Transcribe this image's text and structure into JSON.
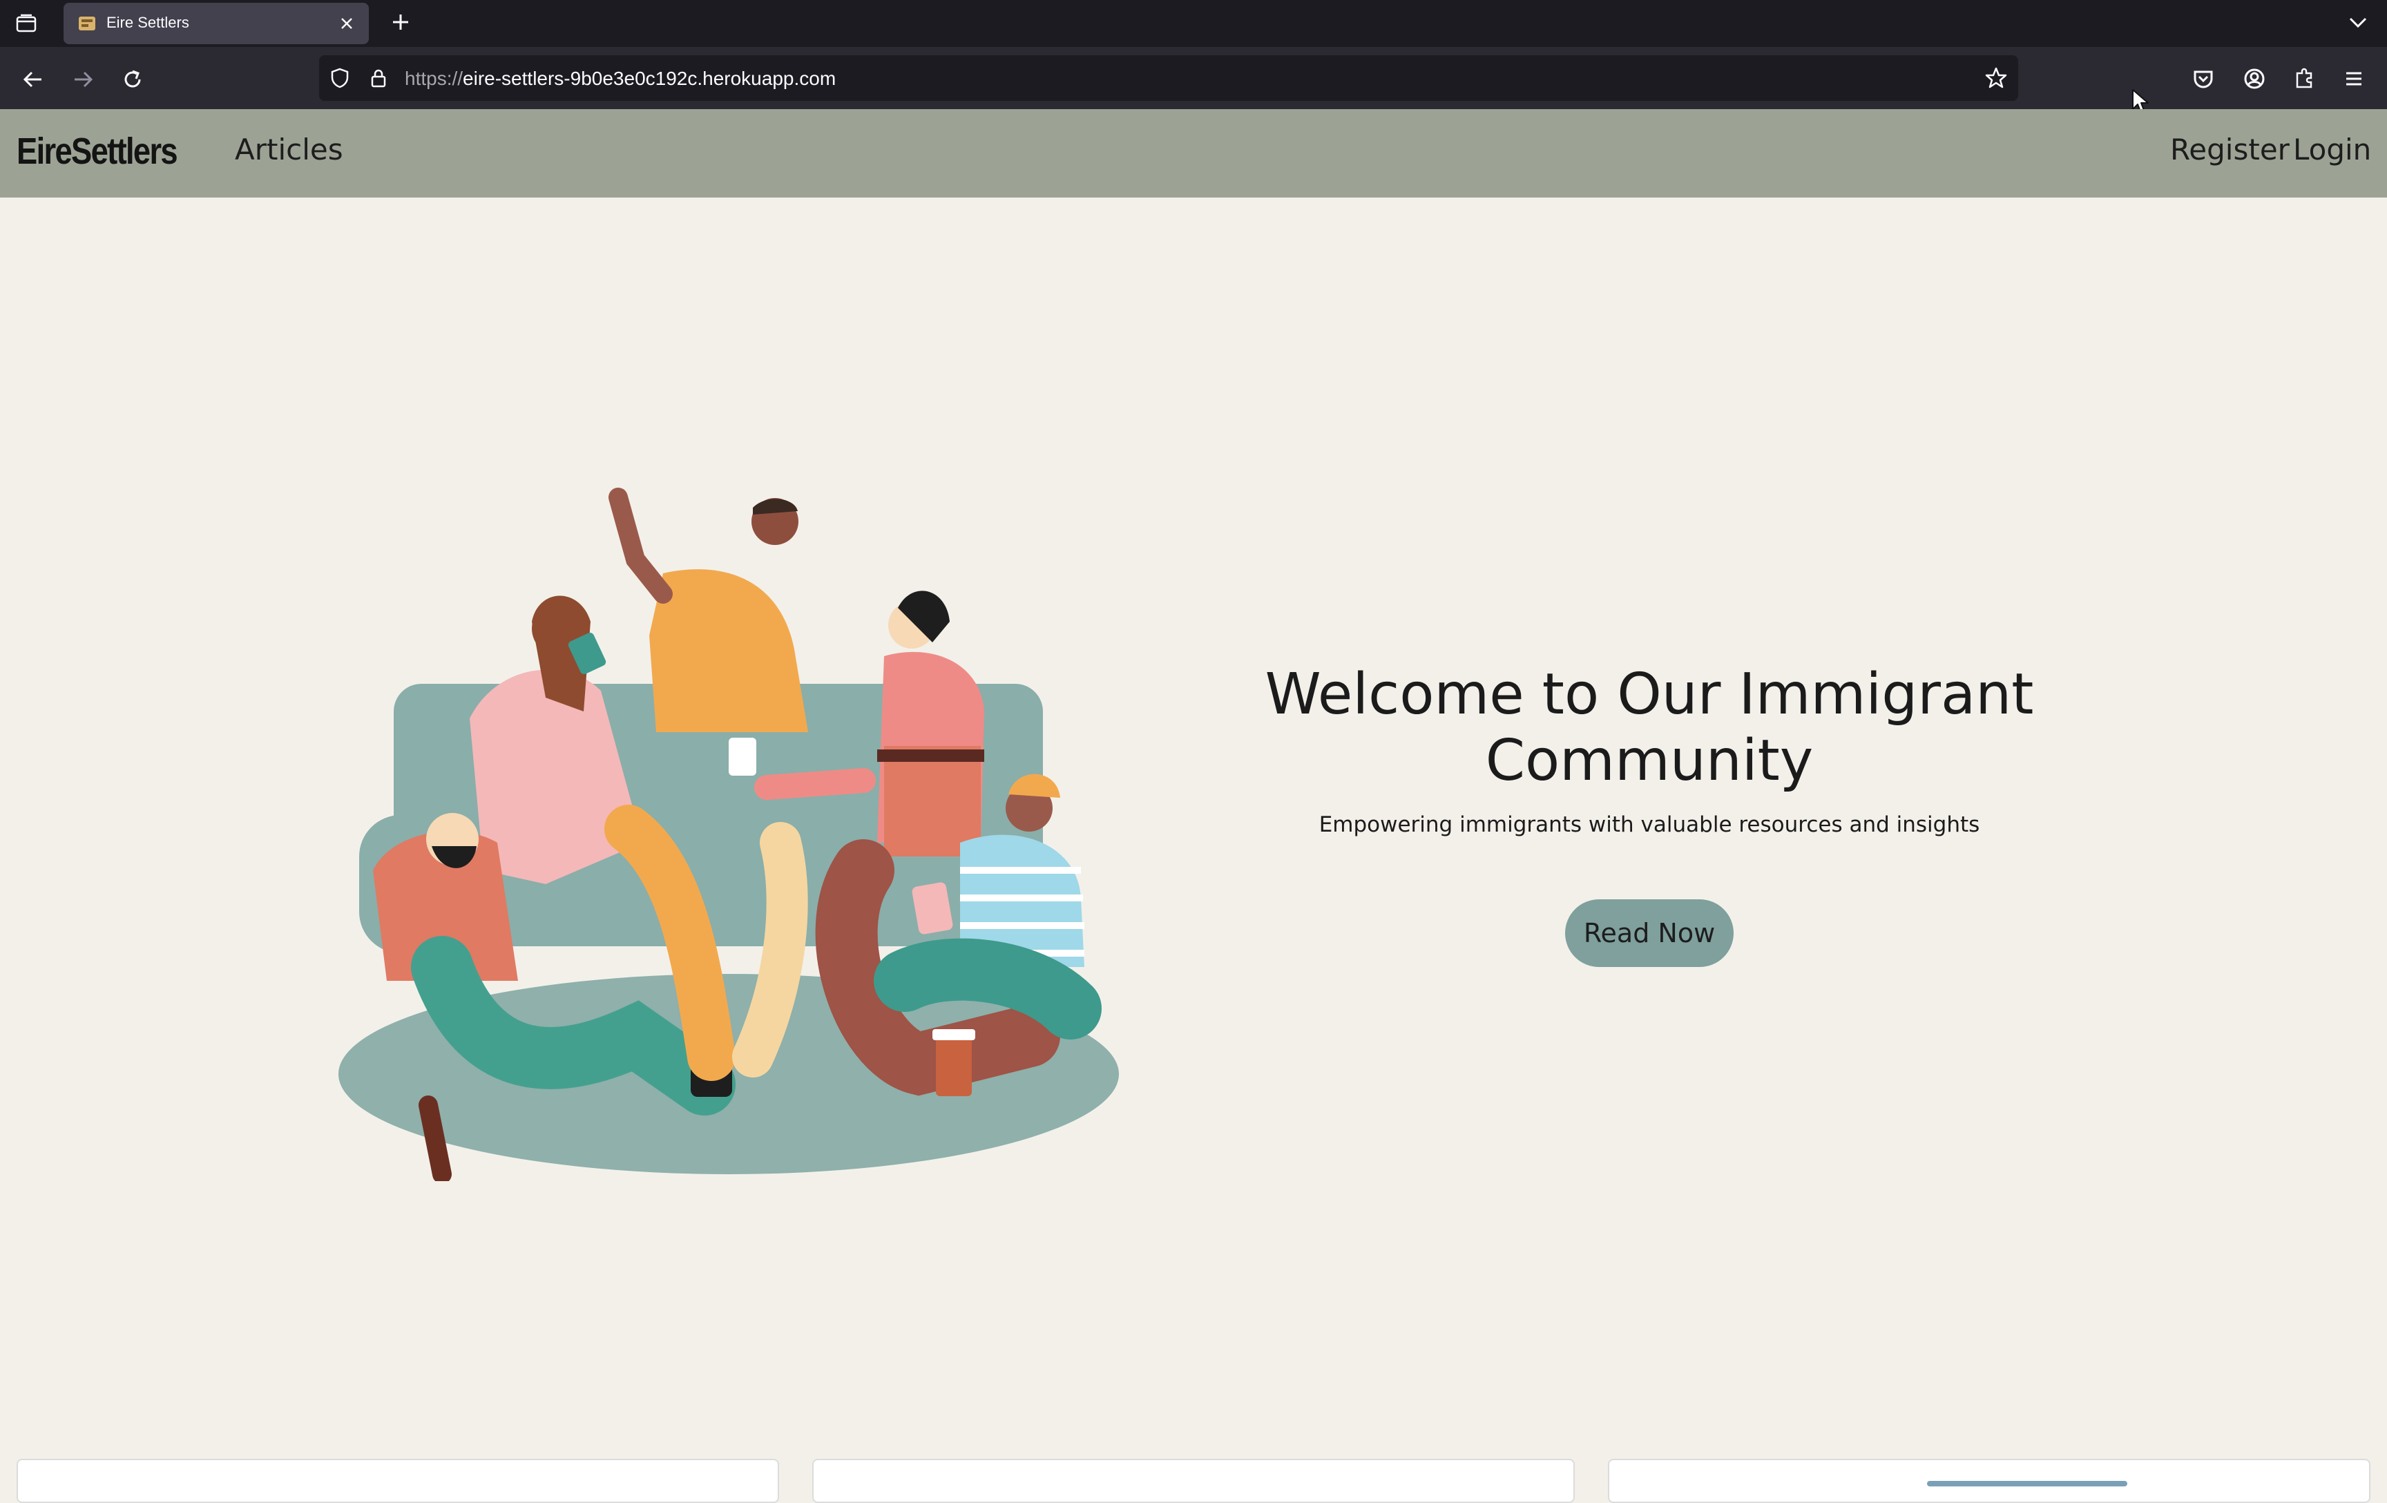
{
  "browser": {
    "tab": {
      "title": "Eire Settlers"
    },
    "url": {
      "scheme": "https://",
      "host": "eire-settlers-9b0e3e0c192c.herokuapp.com"
    }
  },
  "site": {
    "brand": "EireSettlers",
    "nav": {
      "articles": "Articles",
      "register": "Register",
      "login": "Login"
    }
  },
  "hero": {
    "title": "Welcome to Our Immigrant Community",
    "subtitle": "Empowering immigrants with valuable resources and insights",
    "cta": "Read Now"
  },
  "colors": {
    "header_bg": "#9ca395",
    "page_bg": "#f3f0ea",
    "button_bg": "#7fa09c"
  }
}
